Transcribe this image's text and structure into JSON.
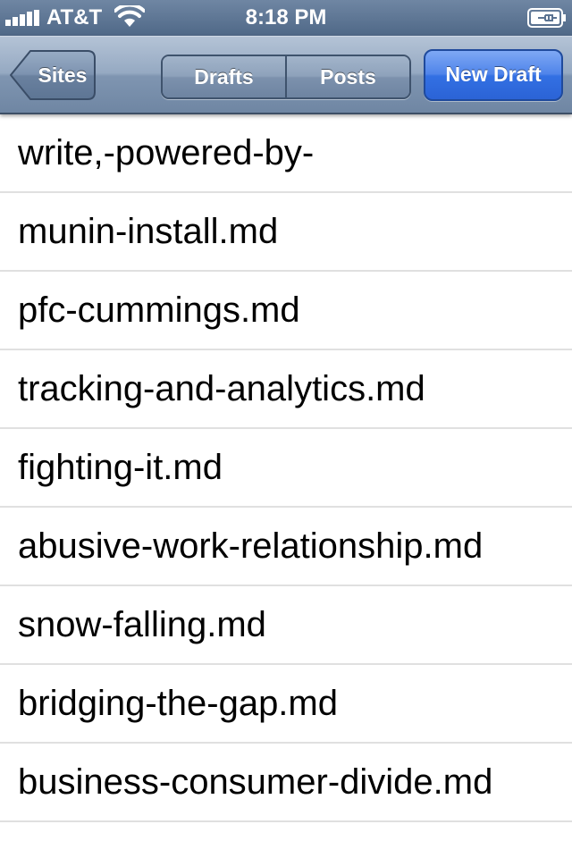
{
  "status_bar": {
    "carrier": "AT&T",
    "time": "8:18 PM",
    "signal_icon": "signal-bars-icon",
    "wifi_icon": "wifi-icon",
    "battery_icon": "battery-charging-icon"
  },
  "nav": {
    "back_label": "Sites",
    "segments": [
      "Drafts",
      "Posts"
    ],
    "new_draft_label": "New Draft"
  },
  "drafts": [
    "write,-powered-by-",
    "munin-install.md",
    "pfc-cummings.md",
    "tracking-and-analytics.md",
    "fighting-it.md",
    "abusive-work-relationship.md",
    "snow-falling.md",
    "bridging-the-gap.md",
    "business-consumer-divide.md"
  ],
  "colors": {
    "nav_bar": "#8ba0bb",
    "accent_blue": "#3370e3",
    "separator": "#e0e0e0"
  }
}
